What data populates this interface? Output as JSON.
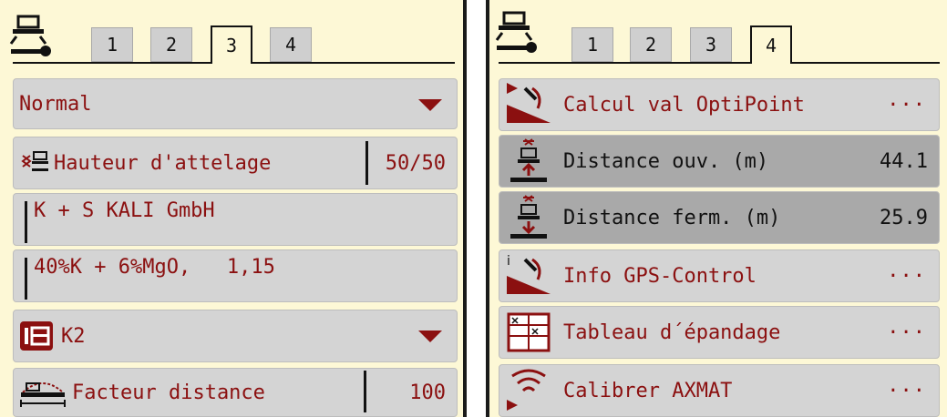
{
  "left_panel": {
    "tabs": [
      "1",
      "2",
      "3",
      "4"
    ],
    "active_tab": "3",
    "rows": {
      "mode": "Normal",
      "hitch_label": "Hauteur d'attelage",
      "hitch_value": "50/50",
      "fertilizer_manufacturer": "K + S KALI GmbH",
      "fertilizer_name": "40%K + 6%MgO,   1,15",
      "disc": "K2",
      "distance_factor_label": "Facteur distance",
      "distance_factor_value": "100"
    }
  },
  "right_panel": {
    "tabs": [
      "1",
      "2",
      "3",
      "4"
    ],
    "active_tab": "4",
    "rows": {
      "optipoint_label": "Calcul val OptiPoint",
      "optipoint_dots": "···",
      "distance_on_label": "Distance ouv. (m)",
      "distance_on_value": "44.1",
      "distance_off_label": "Distance ferm. (m)",
      "distance_off_value": "25.9",
      "gps_info_label": "Info GPS-Control",
      "gps_info_dots": "···",
      "spread_table_label": "Tableau d´épandage",
      "spread_table_dots": "···",
      "axmat_label": "Calibrer AXMAT",
      "axmat_dots": "···"
    }
  },
  "colors": {
    "panel_bg": "#fdf8d6",
    "row_bg": "#d4d4d4",
    "row_dark": "#a9a9a9",
    "accent_red": "#8b1010"
  },
  "icons": [
    "spreader-wrench-icon",
    "hitch-height-icon",
    "disc-icon",
    "distance-factor-icon",
    "optipoint-icon",
    "distance-on-icon",
    "distance-off-icon",
    "gps-info-icon",
    "spread-table-icon",
    "axmat-icon"
  ]
}
